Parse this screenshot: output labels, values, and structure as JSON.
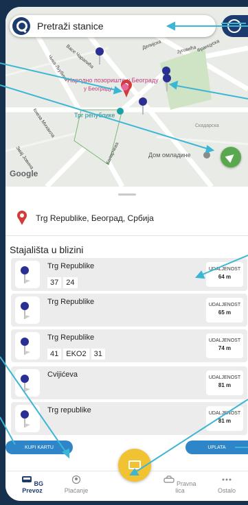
{
  "search": {
    "placeholder": "Pretraži stanice"
  },
  "map": {
    "labels": [
      "Народно позориште у Београду",
      "Трг републике",
      "Дом омладине",
      "Скадарска",
      "Васе Чарапића",
      "Чика-Љубина",
      "Кнеза Михаила",
      "Змај Јовина",
      "Коларчева",
      "Делијска",
      "Француска",
      "Југовића"
    ],
    "attribution": "Google",
    "accent": "#5aa84e"
  },
  "selected_place": {
    "label": "Trg Republike, Београд, Србија",
    "pin_color": "#d63b3b"
  },
  "nearby": {
    "title": "Stajališta u blizini",
    "distance_label": "UDALJENOST",
    "stops": [
      {
        "name": "Trg Republike",
        "lines": [
          "37",
          "24"
        ],
        "distance": "64 m"
      },
      {
        "name": "Trg Republike",
        "lines": [],
        "distance": "65 m"
      },
      {
        "name": "Trg Republike",
        "lines": [
          "41",
          "EKO2",
          "31"
        ],
        "distance": "74 m"
      },
      {
        "name": "Cvijićeva",
        "lines": [],
        "distance": "81 m"
      },
      {
        "name": "Trg republike",
        "lines": [],
        "distance": "81 m"
      }
    ]
  },
  "buttons": {
    "buy_ticket": "KUPI KARTU",
    "top_up": "UPLATA"
  },
  "nav": {
    "items": [
      {
        "label": "BG Prevoz",
        "icon": "bus-icon"
      },
      {
        "label": "Plaćanje",
        "icon": "person-icon"
      },
      {
        "label": "Pravna lica",
        "icon": "car-icon"
      },
      {
        "label": "Ostalo",
        "icon": "more-icon"
      }
    ],
    "fab_icon": "ticket-icon",
    "active_color": "#1c3b6e"
  },
  "colors": {
    "brand_dark": "#1c3b6e",
    "fab": "#f1c232",
    "button": "#2e86c8",
    "annotation": "#3bb6d4"
  }
}
